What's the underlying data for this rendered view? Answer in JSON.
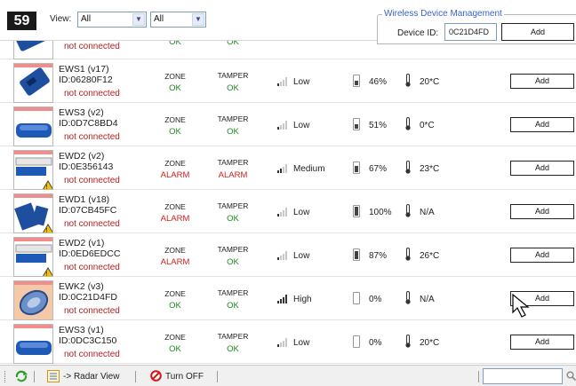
{
  "header": {
    "count_badge": "59",
    "view_label": "View:",
    "view_select_1": "All",
    "view_select_2": "All"
  },
  "wireless_device_management": {
    "title": "Wireless Device Management",
    "device_id_label": "Device ID:",
    "device_id_value": "0C21D4FD",
    "add_label": "Add"
  },
  "partial_row": {
    "status": "not connected",
    "zone_state": "OK",
    "tamper_state": "OK"
  },
  "rows": [
    {
      "name": "EWS1 (v17)",
      "id": "ID:06280F12",
      "status": "not connected",
      "zone_title": "ZONE",
      "zone_state": "OK",
      "tamper_title": "TAMPER",
      "tamper_state": "OK",
      "signal": "Low",
      "battery": "46%",
      "temperature": "20*C",
      "add_label": "Add"
    },
    {
      "name": "EWS3 (v2)",
      "id": "ID:0D7C8BD4",
      "status": "not connected",
      "zone_title": "ZONE",
      "zone_state": "OK",
      "tamper_title": "TAMPER",
      "tamper_state": "OK",
      "signal": "Low",
      "battery": "51%",
      "temperature": "0*C",
      "add_label": "Add"
    },
    {
      "name": "EWD2 (v2)",
      "id": "ID:0E356143",
      "status": "not connected",
      "zone_title": "ZONE",
      "zone_state": "ALARM",
      "tamper_title": "TAMPER",
      "tamper_state": "ALARM",
      "signal": "Medium",
      "battery": "67%",
      "temperature": "23*C",
      "add_label": "Add"
    },
    {
      "name": "EWD1 (v18)",
      "id": "ID:07CB45FC",
      "status": "not connected",
      "zone_title": "ZONE",
      "zone_state": "ALARM",
      "tamper_title": "TAMPER",
      "tamper_state": "OK",
      "signal": "Low",
      "battery": "100%",
      "temperature": "N/A",
      "add_label": "Add"
    },
    {
      "name": "EWD2 (v1)",
      "id": "ID:0ED6EDCC",
      "status": "not connected",
      "zone_title": "ZONE",
      "zone_state": "ALARM",
      "tamper_title": "TAMPER",
      "tamper_state": "OK",
      "signal": "Low",
      "battery": "87%",
      "temperature": "26*C",
      "add_label": "Add"
    },
    {
      "name": "EWK2 (v3)",
      "id": "ID:0C21D4FD",
      "status": "not connected",
      "zone_title": "ZONE",
      "zone_state": "OK",
      "tamper_title": "TAMPER",
      "tamper_state": "OK",
      "signal": "High",
      "battery": "0%",
      "temperature": "N/A",
      "add_label": "Add"
    },
    {
      "name": "EWS3 (v1)",
      "id": "ID:0DC3C150",
      "status": "not connected",
      "zone_title": "ZONE",
      "zone_state": "OK",
      "tamper_title": "TAMPER",
      "tamper_state": "OK",
      "signal": "Low",
      "battery": "0%",
      "temperature": "20*C",
      "add_label": "Add"
    }
  ],
  "statusbar": {
    "radar_view_label": "-> Radar View",
    "turn_off_label": "Turn OFF"
  },
  "colors": {
    "ok": "#1f8a1f",
    "alarm": "#d01e1e",
    "not_connected": "#b22020",
    "accent": "#3a63c8"
  }
}
